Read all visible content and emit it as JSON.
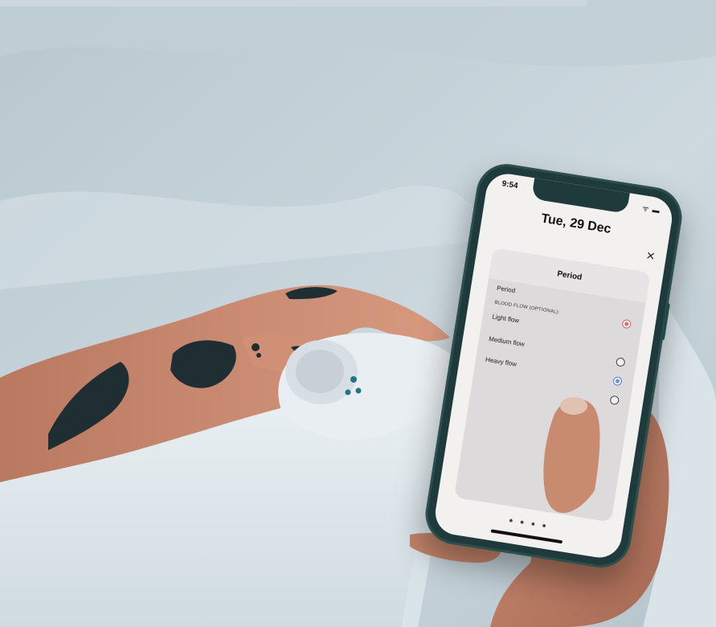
{
  "phone": {
    "status_time": "9:54",
    "date_title": "Tue, 29 Dec",
    "close_glyph": "×",
    "card": {
      "title": "Period",
      "period_label": "Period",
      "blood_flow_label": "BLOOD FLOW (OPTIONAL):",
      "options": [
        {
          "label": "Light flow",
          "state": "selected-red"
        },
        {
          "label": "Medium flow",
          "state": "unselected"
        },
        {
          "label": "Heavy flow",
          "state": "selected-blue"
        }
      ]
    }
  },
  "scene": {
    "background_color": "#c7d3da",
    "blanket_color": "#e3ecf1",
    "skin_color": "#c58b72",
    "tattoo_color": "#1f2e33",
    "device_color": "#e9eef2",
    "device_accent": "#2b6f8f"
  },
  "icons": {
    "close": "close-icon",
    "wifi": "wifi-icon",
    "battery": "battery-icon"
  }
}
